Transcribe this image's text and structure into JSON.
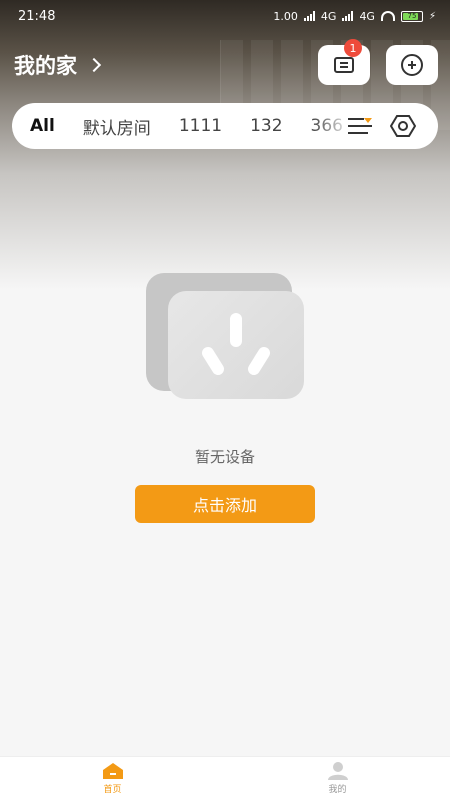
{
  "status_bar": {
    "time": "21:48",
    "network_1": "1.00",
    "network_2": "4G",
    "network_3": "4G",
    "battery": "75"
  },
  "header": {
    "title": "我的家",
    "message_badge": "1"
  },
  "tabs": [
    {
      "label": "All",
      "active": true
    },
    {
      "label": "默认房间",
      "active": false
    },
    {
      "label": "1111",
      "active": false
    },
    {
      "label": "132",
      "active": false
    },
    {
      "label": "366",
      "active": false
    }
  ],
  "empty_state": {
    "message": "暂无设备",
    "button_label": "点击添加"
  },
  "bottom_nav": [
    {
      "label": "首页",
      "icon": "home-icon",
      "active": true
    },
    {
      "label": "我的",
      "icon": "profile-icon",
      "active": false
    }
  ],
  "colors": {
    "accent": "#f39a15",
    "badge": "#ee4b3b"
  }
}
